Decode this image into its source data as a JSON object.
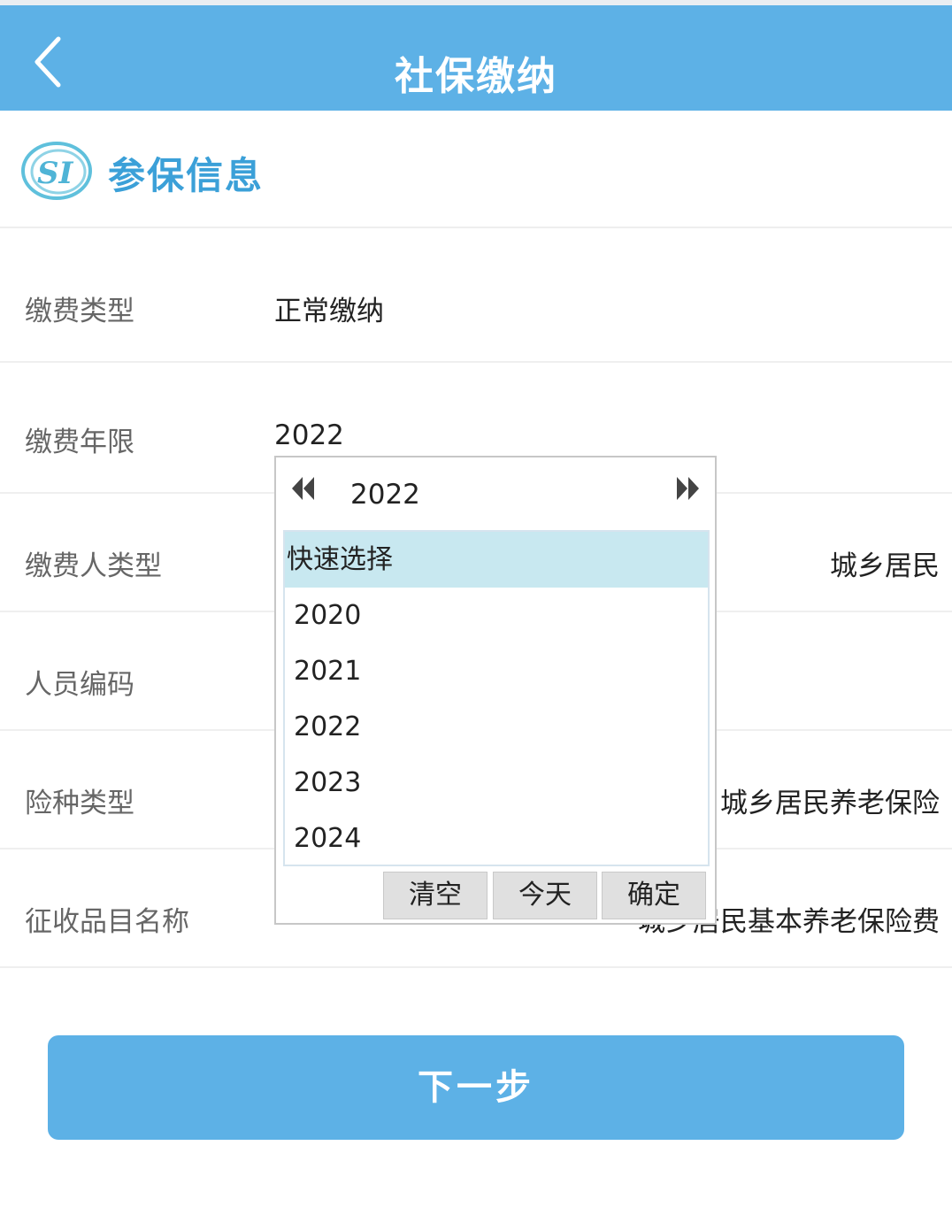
{
  "header": {
    "title": "社保缴纳",
    "back_icon": "chevron-left-icon"
  },
  "section": {
    "title": "参保信息",
    "logo_text": "SI"
  },
  "form": {
    "payment_type": {
      "label": "缴费类型",
      "value": "正常缴纳"
    },
    "payment_year": {
      "label": "缴费年限",
      "value": "2022"
    },
    "payer_type": {
      "label": "缴费人类型",
      "value": "城乡居民"
    },
    "person_code": {
      "label": "人员编码",
      "value": ""
    },
    "insurance_type": {
      "label": "险种类型",
      "value": "城乡居民养老保险"
    },
    "collection_item": {
      "label": "征收品目名称",
      "value": "城乡居民基本养老保险费"
    }
  },
  "picker": {
    "year": "2022",
    "quick_select": "快速选择",
    "years": [
      "2020",
      "2021",
      "2022",
      "2023",
      "2024"
    ],
    "clear": "清空",
    "today": "今天",
    "confirm": "确定"
  },
  "next_button": "下一步",
  "colors": {
    "header_bg": "#5db1e6",
    "accent": "#3ba0d8",
    "highlight": "#c8e8f0"
  }
}
